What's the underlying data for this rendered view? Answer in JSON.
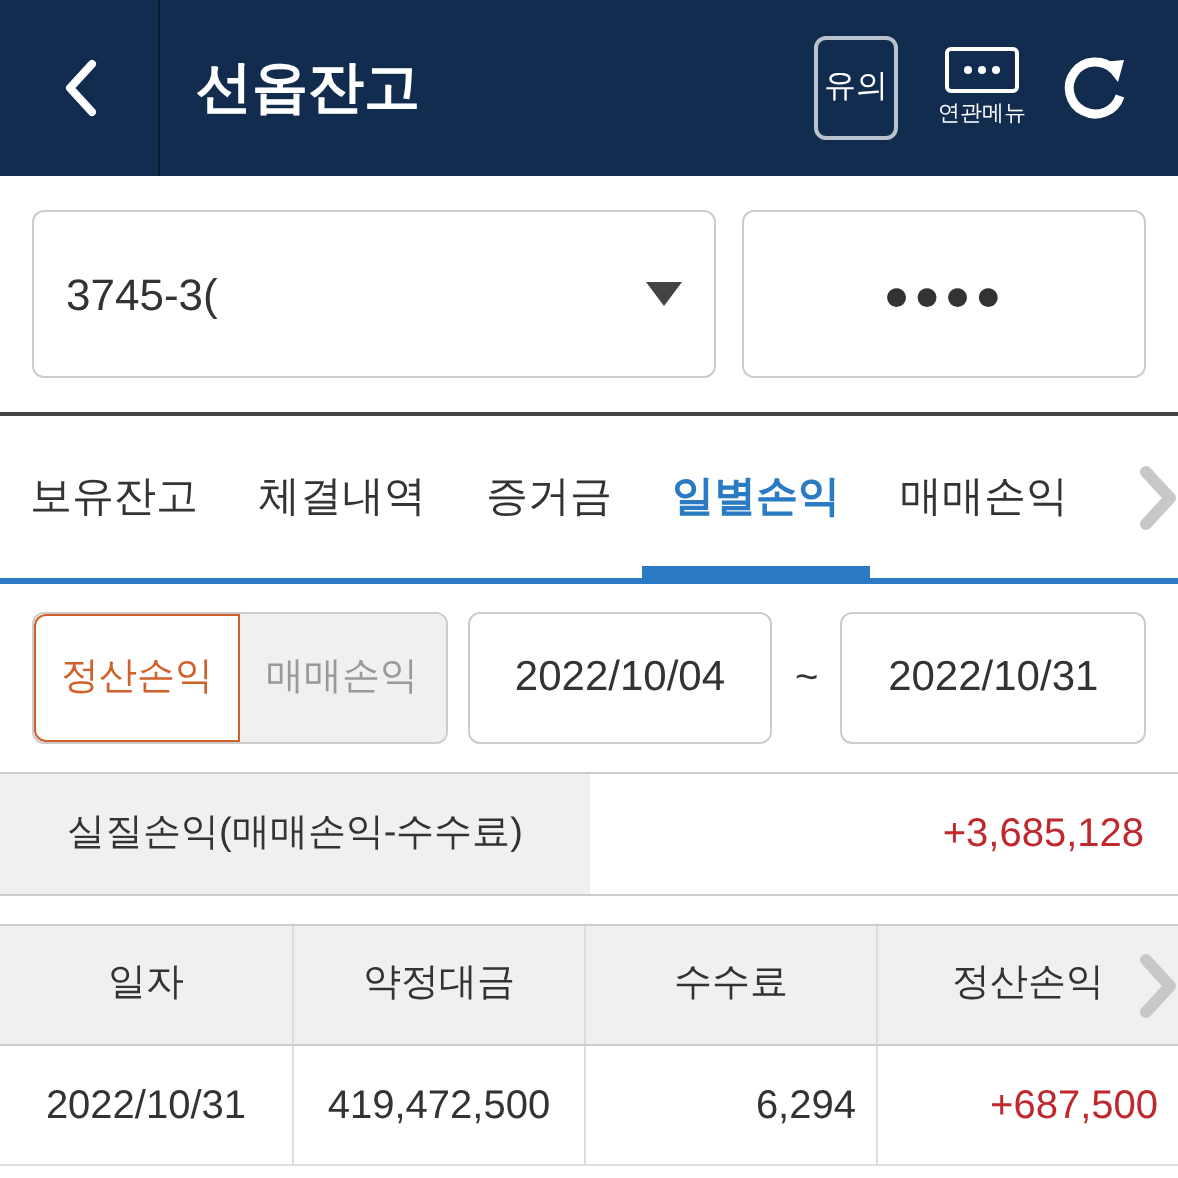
{
  "header": {
    "title": "선옵잔고",
    "notice_button": "유의",
    "menu_button": "연관메뉴"
  },
  "account": {
    "value": "3745-3(",
    "password": "●●●●"
  },
  "tabs": [
    {
      "label": "보유잔고",
      "selected": false
    },
    {
      "label": "체결내역",
      "selected": false
    },
    {
      "label": "증거금",
      "selected": false
    },
    {
      "label": "일별손익",
      "selected": true
    },
    {
      "label": "매매손익",
      "selected": false
    }
  ],
  "mode_toggle": [
    {
      "label": "정산손익",
      "selected": true
    },
    {
      "label": "매매손익",
      "selected": false
    }
  ],
  "date_range": {
    "start": "2022/10/04",
    "separator": "~",
    "end": "2022/10/31"
  },
  "summary": {
    "label": "실질손익(매매손익-수수료)",
    "value": "+3,685,128"
  },
  "table": {
    "columns": [
      "일자",
      "약정대금",
      "수수료",
      "정산손익"
    ],
    "rows": [
      [
        "2022/10/31",
        "419,472,500",
        "6,294",
        "+687,500"
      ]
    ]
  }
}
